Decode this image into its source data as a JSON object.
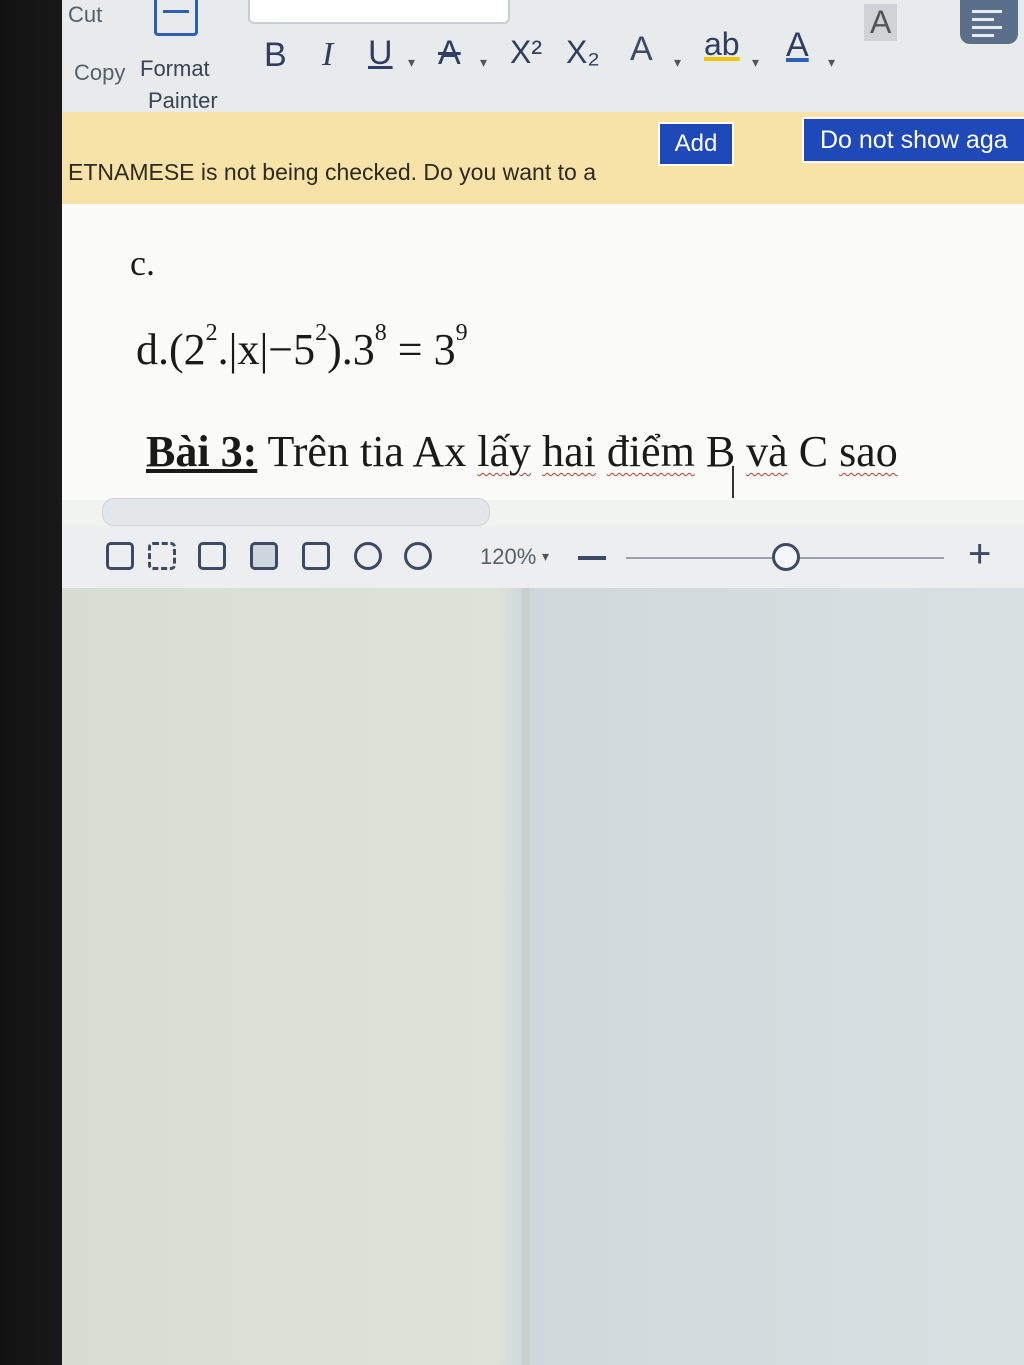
{
  "ribbon": {
    "cut_label": "Cut",
    "copy_label": "Copy",
    "format_painter_line1": "Format",
    "format_painter_line2": "Painter",
    "format_buttons": {
      "bold": "B",
      "italic": "I",
      "underline": "U",
      "strikethrough": "A",
      "superscript": "X²",
      "subscript": "X₂",
      "text_effects": "A",
      "highlight": "ab",
      "font_color": "A",
      "char_shading": "A"
    }
  },
  "notification": {
    "message": "ETNAMESE is not being checked. Do you want to a",
    "add_label": "Add",
    "dismiss_label": "Do not show aga"
  },
  "document": {
    "line_c": "c.",
    "line_d": {
      "prefix": "d.(2",
      "exp1": "2",
      "mid1": ".|x|−5",
      "exp2": "2",
      "mid2": ").3",
      "exp3": "8",
      "mid3": " = 3",
      "exp4": "9"
    },
    "bai3": {
      "label": "Bài 3:",
      "w1": "Trên tia Ax",
      "w2": "lấy",
      "w3": "hai",
      "w4": "điểm",
      "w5": "B",
      "w6": "và",
      "w7": "C",
      "w8": "sao"
    }
  },
  "statusbar": {
    "zoom_level": "120%",
    "zoom_minus": "−",
    "zoom_plus": "+",
    "zoom_fraction": 0.5
  },
  "colors": {
    "accent_blue": "#1f48b8",
    "notify_bg": "#f7e2a8",
    "ribbon_icon": "#2f3e63"
  }
}
